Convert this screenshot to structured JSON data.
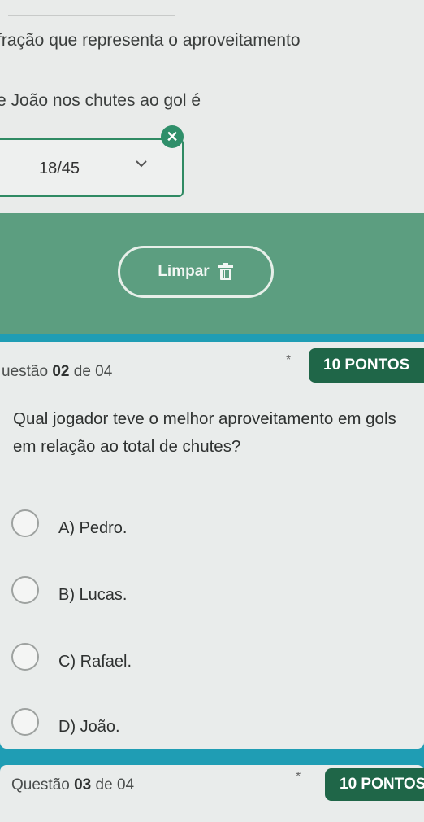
{
  "question1": {
    "text_line1": "fração que representa o aproveitamento",
    "text_line2": "e João nos chutes ao gol é",
    "answer_value": "18/45",
    "wrong_mark": "✕",
    "clear_button_label": "Limpar"
  },
  "question2": {
    "label_prefix": "uestão",
    "number": "02",
    "of_total": "de 04",
    "required_mark": "*",
    "points": "10 PONTOS",
    "text": "Qual jogador teve o melhor aproveitamento em gols em relação ao total de chutes?",
    "options": [
      {
        "label": "A) Pedro."
      },
      {
        "label": "B) Lucas."
      },
      {
        "label": "C) Rafael."
      },
      {
        "label": "D) João."
      }
    ]
  },
  "question3": {
    "label_prefix": "Questão",
    "number": "03",
    "of_total": "de 04",
    "required_mark": "*",
    "points": "10 PONTOS"
  },
  "colors": {
    "accent_green": "#1f6648",
    "band_green": "#5c9e80",
    "page_teal": "#1f9db4",
    "error_badge": "#2f8f6a"
  },
  "icons": [
    "close-icon",
    "chevron-down-icon",
    "trash-icon",
    "star-icon"
  ]
}
